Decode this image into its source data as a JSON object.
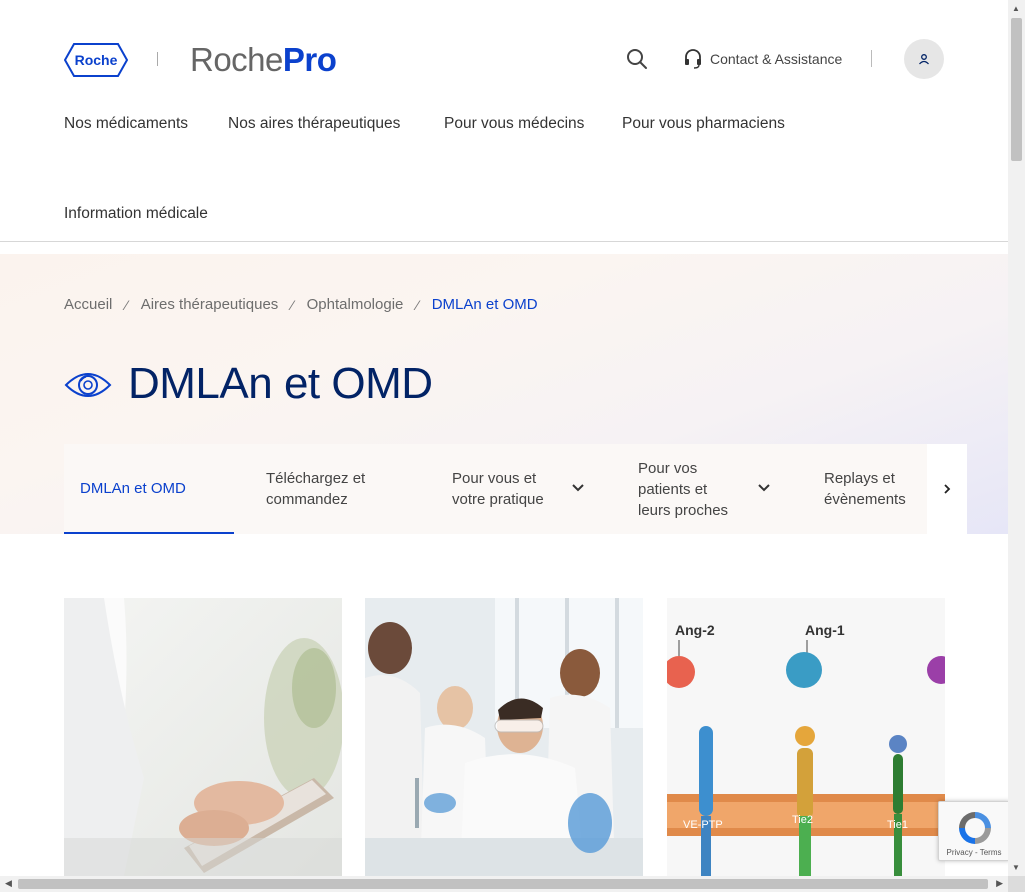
{
  "header": {
    "roche_logo_text": "Roche",
    "brand_prefix": "Roche",
    "brand_suffix": "Pro",
    "contact_label": "Contact & Assistance"
  },
  "nav": {
    "items": [
      {
        "label": "Nos médicaments"
      },
      {
        "label": "Nos aires thérapeutiques"
      },
      {
        "label": "Pour vous médecins"
      },
      {
        "label": "Pour vous pharmaciens"
      },
      {
        "label": "Information médicale"
      }
    ]
  },
  "breadcrumb": {
    "items": [
      "Accueil",
      "Aires thérapeutiques",
      "Ophtalmologie",
      "DMLAn et OMD"
    ],
    "separator": "⁄"
  },
  "page": {
    "title": "DMLAn et OMD"
  },
  "tabs": [
    {
      "label": "DMLAn et OMD",
      "active": true
    },
    {
      "label": "Téléchargez et commandez"
    },
    {
      "label": "Pour vous et votre pratique",
      "has_dropdown": true
    },
    {
      "label": "Pour vos patients et leurs proches",
      "has_dropdown": true
    },
    {
      "label": "Replays et évènements"
    }
  ],
  "cards": {
    "diagram_labels": [
      "Ang-2",
      "Ang-1",
      "VE-PTP",
      "Tie2",
      "Tie1"
    ]
  },
  "recaptcha": {
    "privacy": "Privacy",
    "terms": "Terms",
    "separator": " - "
  },
  "colors": {
    "accent": "#0b41cd",
    "title": "#022366"
  }
}
